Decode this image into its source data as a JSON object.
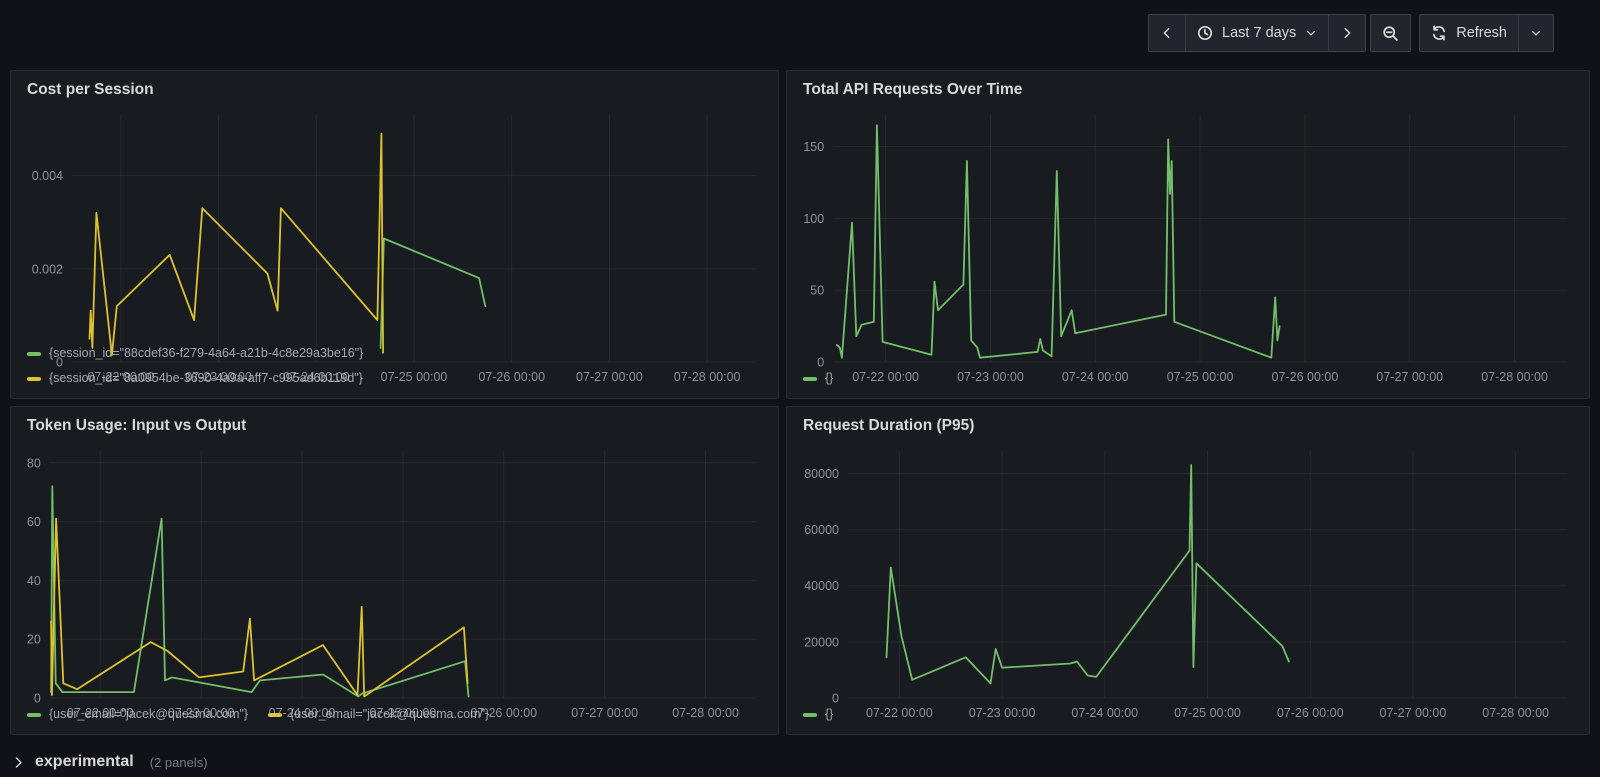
{
  "toolbar": {
    "time_range": {
      "label": "Last 7 days"
    },
    "refresh": {
      "label": "Refresh"
    }
  },
  "row": {
    "title": "experimental",
    "count": "(2 panels)"
  },
  "colors": {
    "green": "#73bf69",
    "yellow": "#dcc22c",
    "page_bg": "#111217",
    "panel_bg": "#181b1f",
    "grid": "rgba(204,204,220,0.08)"
  },
  "x_axis": {
    "domain_hours": [
      0,
      168
    ],
    "tick_hours": [
      12,
      36,
      60,
      84,
      108,
      132,
      156
    ],
    "tick_labels": [
      "07-22 00:00",
      "07-23 00:00",
      "07-24 00:00",
      "07-25 00:00",
      "07-26 00:00",
      "07-27 00:00",
      "07-28 00:00"
    ]
  },
  "chart_data": [
    {
      "type": "line",
      "title": "Cost per Session",
      "xlabel": "",
      "ylabel": "",
      "y_max": 0.0053,
      "y_ticks": [
        0,
        0.002,
        0.004
      ],
      "y_tick_labels": [
        "0",
        "0.002",
        "0.004"
      ],
      "grid": true,
      "legend_position": "bottom",
      "legend_stack": true,
      "series": [
        {
          "name": "{session_id=\"88cdef36-f279-4a64-a21b-4c8e29a3be16\"}",
          "color": "green",
          "points": [
            [
              75.8,
              0.0003
            ],
            [
              76.6,
              0.00265
            ],
            [
              100,
              0.0018
            ],
            [
              101.5,
              0.0012
            ]
          ]
        },
        {
          "name": "{session_id=\"8a0954be-3690-4a9a-aff7-c995ad6b119d\"}",
          "color": "yellow",
          "points": [
            [
              4.3,
              0.0005
            ],
            [
              4.6,
              0.0011
            ],
            [
              5,
              0.0003
            ],
            [
              6,
              0.0032
            ],
            [
              9.8,
              0.00015
            ],
            [
              11,
              0.0012
            ],
            [
              24,
              0.0023
            ],
            [
              30,
              0.0009
            ],
            [
              32,
              0.0033
            ],
            [
              48,
              0.0019
            ],
            [
              50.5,
              0.0011
            ],
            [
              51.3,
              0.0033
            ],
            [
              75,
              0.0009
            ],
            [
              76,
              0.0049
            ],
            [
              76.4,
              0.0002
            ]
          ]
        }
      ]
    },
    {
      "type": "line",
      "title": "Total API Requests Over Time",
      "xlabel": "",
      "ylabel": "",
      "y_max": 172,
      "y_ticks": [
        0,
        50,
        100,
        150
      ],
      "y_tick_labels": [
        "0",
        "50",
        "100",
        "150"
      ],
      "grid": true,
      "legend_position": "bottom",
      "legend_stack": false,
      "series": [
        {
          "name": "{}",
          "color": "green",
          "points": [
            [
              0.8,
              12
            ],
            [
              1.5,
              10
            ],
            [
              2,
              3
            ],
            [
              4.3,
              97
            ],
            [
              5.3,
              18
            ],
            [
              6.5,
              26
            ],
            [
              9.3,
              28
            ],
            [
              10,
              165
            ],
            [
              11.3,
              14
            ],
            [
              22.5,
              5
            ],
            [
              23.2,
              56
            ],
            [
              24,
              36
            ],
            [
              29.8,
              54
            ],
            [
              30.6,
              140
            ],
            [
              31.6,
              15
            ],
            [
              33,
              10
            ],
            [
              33.6,
              3
            ],
            [
              46.8,
              7
            ],
            [
              47.4,
              16
            ],
            [
              48,
              8
            ],
            [
              50,
              4
            ],
            [
              51.2,
              133
            ],
            [
              52.2,
              18
            ],
            [
              54.6,
              36
            ],
            [
              55.4,
              20
            ],
            [
              76.2,
              33
            ],
            [
              76.7,
              155
            ],
            [
              77.1,
              117
            ],
            [
              77.5,
              140
            ],
            [
              78.1,
              28
            ],
            [
              100.3,
              3
            ],
            [
              101.2,
              45
            ],
            [
              101.7,
              15
            ],
            [
              102.2,
              25
            ]
          ]
        }
      ]
    },
    {
      "type": "line",
      "title": "Token Usage: Input vs Output",
      "xlabel": "",
      "ylabel": "",
      "y_max": 84,
      "y_ticks": [
        0,
        20,
        40,
        60,
        80
      ],
      "y_tick_labels": [
        "0",
        "20",
        "40",
        "60",
        "80"
      ],
      "grid": true,
      "legend_position": "bottom",
      "legend_stack": false,
      "series": [
        {
          "name": "{user_email=\"jacek@quesma.com\"}",
          "color": "green",
          "points": [
            [
              0.3,
              2
            ],
            [
              0.6,
              72
            ],
            [
              1.4,
              5
            ],
            [
              3,
              2
            ],
            [
              20,
              2
            ],
            [
              26.6,
              61
            ],
            [
              27.4,
              6
            ],
            [
              29,
              7
            ],
            [
              48,
              2
            ],
            [
              50,
              6
            ],
            [
              65,
              8
            ],
            [
              73.4,
              0.5
            ],
            [
              74.3,
              1.5
            ],
            [
              98.8,
              12.5
            ],
            [
              99.6,
              0.5
            ]
          ]
        },
        {
          "name": "{user_email=\"jacek@quesma.com\"}",
          "color": "yellow",
          "points": [
            [
              0.3,
              26
            ],
            [
              0.5,
              1
            ],
            [
              1.5,
              61
            ],
            [
              3.2,
              5
            ],
            [
              6.5,
              3
            ],
            [
              24,
              19
            ],
            [
              28,
              16
            ],
            [
              35.5,
              7
            ],
            [
              46,
              9
            ],
            [
              47.6,
              27
            ],
            [
              48.6,
              6
            ],
            [
              65,
              18
            ],
            [
              73.2,
              1
            ],
            [
              74.2,
              31
            ],
            [
              74.8,
              0.5
            ],
            [
              98.5,
              24
            ],
            [
              99.4,
              5
            ]
          ]
        }
      ]
    },
    {
      "type": "line",
      "title": "Request Duration (P95)",
      "xlabel": "",
      "ylabel": "",
      "y_max": 88000,
      "y_ticks": [
        0,
        20000,
        40000,
        60000,
        80000
      ],
      "y_tick_labels": [
        "0",
        "20000",
        "40000",
        "60000",
        "80000"
      ],
      "grid": true,
      "legend_position": "bottom",
      "legend_stack": false,
      "series": [
        {
          "name": "{}",
          "color": "green",
          "points": [
            [
              9,
              14500
            ],
            [
              10,
              46500
            ],
            [
              12.5,
              22000
            ],
            [
              15,
              6500
            ],
            [
              27.5,
              14500
            ],
            [
              33.3,
              5200
            ],
            [
              34.5,
              17500
            ],
            [
              36,
              10800
            ],
            [
              52,
              12300
            ],
            [
              53.5,
              13000
            ],
            [
              56,
              8000
            ],
            [
              58,
              7500
            ],
            [
              79.8,
              52500
            ],
            [
              80.2,
              83000
            ],
            [
              80.7,
              11000
            ],
            [
              81.4,
              48000
            ],
            [
              101.5,
              18500
            ],
            [
              103,
              13000
            ]
          ]
        }
      ]
    }
  ]
}
